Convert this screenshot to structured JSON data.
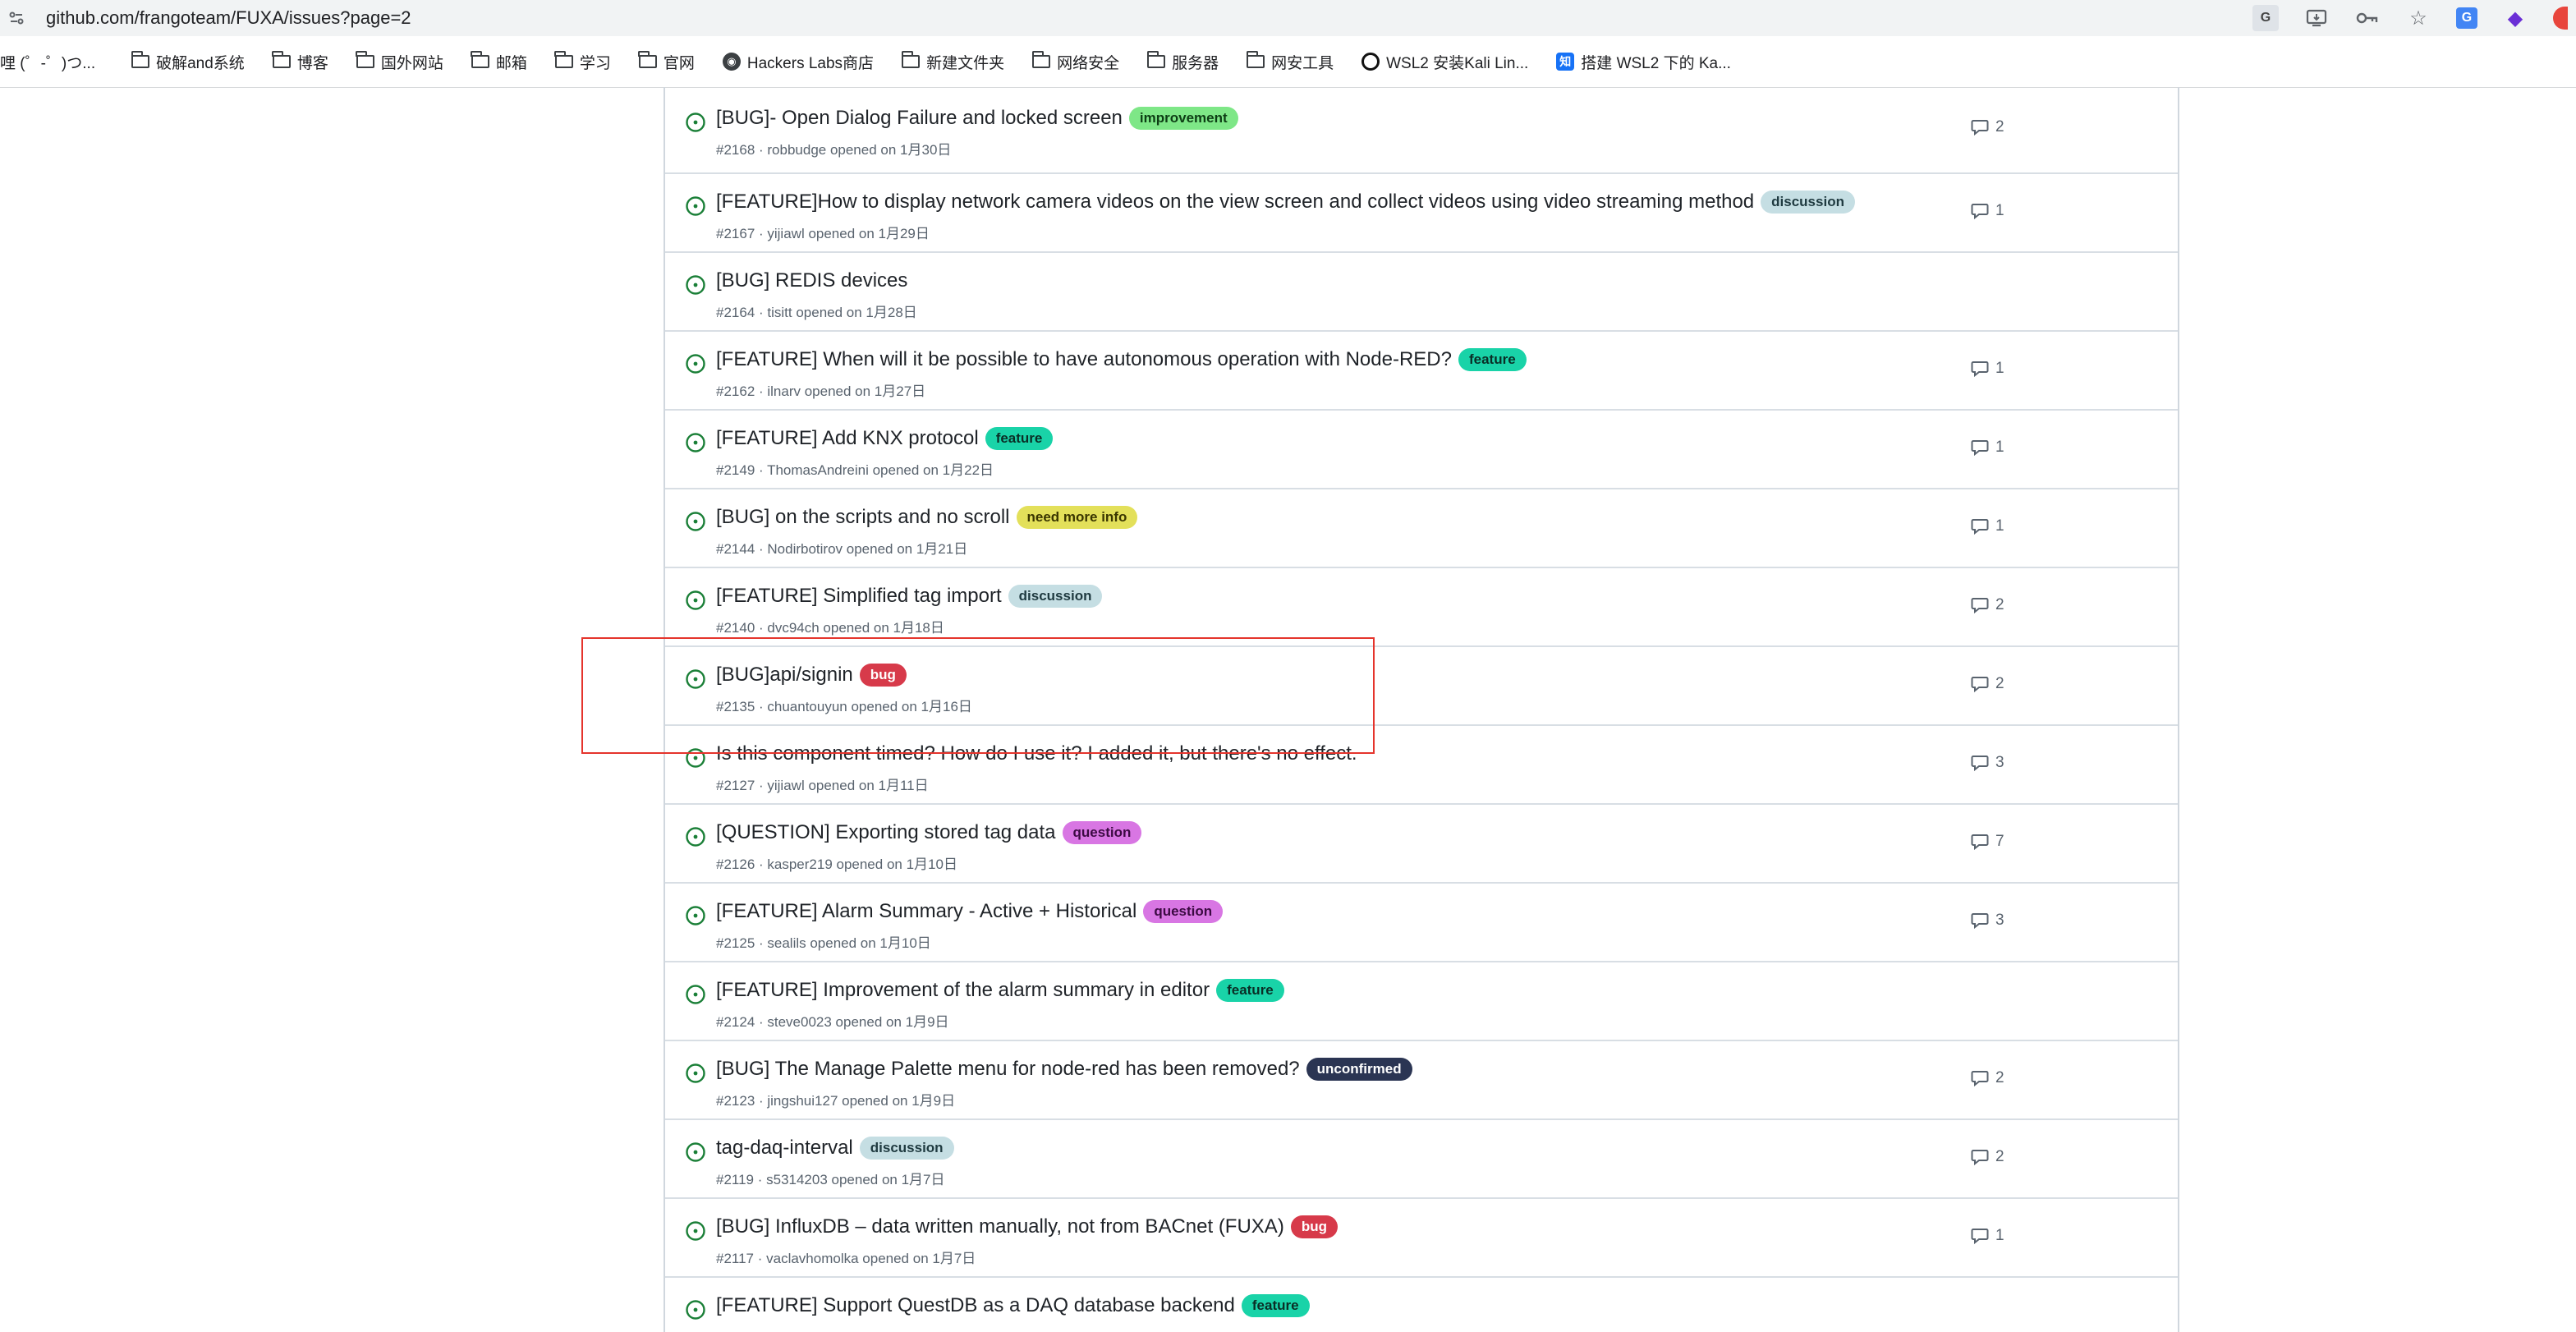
{
  "browser": {
    "url": "github.com/frangoteam/FUXA/issues?page=2",
    "bookmarks": [
      {
        "label": "哩 (゜-゜)つ...",
        "icon": "none"
      },
      {
        "label": "破解and系统",
        "icon": "folder-icon"
      },
      {
        "label": "博客",
        "icon": "folder-icon"
      },
      {
        "label": "国外网站",
        "icon": "folder-icon"
      },
      {
        "label": "邮箱",
        "icon": "folder-icon"
      },
      {
        "label": "学习",
        "icon": "folder-icon"
      },
      {
        "label": "官网",
        "icon": "folder-icon"
      },
      {
        "label": "Hackers Labs商店",
        "icon": "hackers-labs-icon"
      },
      {
        "label": "新建文件夹",
        "icon": "folder-icon"
      },
      {
        "label": "网络安全",
        "icon": "folder-icon"
      },
      {
        "label": "服务器",
        "icon": "folder-icon"
      },
      {
        "label": "网安工具",
        "icon": "folder-icon"
      },
      {
        "label": "WSL2 安装Kali Lin...",
        "icon": "github-icon"
      },
      {
        "label": "搭建 WSL2 下的 Ka...",
        "icon": "zhihu-icon"
      }
    ]
  },
  "issues": [
    {
      "title": "[BUG]- Open Dialog Failure and locked screen",
      "labels": [
        {
          "text": "improvement",
          "bg": "#7ee787",
          "fg": "#0d3d14"
        }
      ],
      "meta": "#2168 · robbudge opened on 1月30日",
      "comments": "2"
    },
    {
      "title": "[FEATURE]How to display network camera videos on the view screen and collect videos using video streaming method",
      "labels": [
        {
          "text": "discussion",
          "bg": "#c5dee3",
          "fg": "#1f3a40"
        }
      ],
      "meta": "#2167 · yijiawl opened on 1月29日",
      "comments": "1"
    },
    {
      "title": "[BUG] REDIS devices",
      "labels": [],
      "meta": "#2164 · tisitt opened on 1月28日",
      "comments": ""
    },
    {
      "title": "[FEATURE] When will it be possible to have autonomous operation with Node-RED?",
      "labels": [
        {
          "text": "feature",
          "bg": "#19d3a8",
          "fg": "#0a2e26"
        }
      ],
      "meta": "#2162 · ilnarv opened on 1月27日",
      "comments": "1"
    },
    {
      "title": "[FEATURE] Add KNX protocol",
      "labels": [
        {
          "text": "feature",
          "bg": "#19d3a8",
          "fg": "#0a2e26"
        }
      ],
      "meta": "#2149 · ThomasAndreini opened on 1月22日",
      "comments": "1"
    },
    {
      "title": "[BUG] on the scripts and no scroll",
      "labels": [
        {
          "text": "need more info",
          "bg": "#e3e05a",
          "fg": "#3a3600"
        }
      ],
      "meta": "#2144 · Nodirbotirov opened on 1月21日",
      "comments": "1"
    },
    {
      "title": "[FEATURE] Simplified tag import",
      "labels": [
        {
          "text": "discussion",
          "bg": "#c5dee3",
          "fg": "#1f3a40"
        }
      ],
      "meta": "#2140 · dvc94ch opened on 1月18日",
      "comments": "2"
    },
    {
      "title": "[BUG]api/signin",
      "labels": [
        {
          "text": "bug",
          "bg": "#d73a4a",
          "fg": "#ffffff"
        }
      ],
      "meta": "#2135 · chuantouyun opened on 1月16日",
      "comments": "2"
    },
    {
      "title": "Is this component timed? How do I use it? I added it, but there's no effect.",
      "labels": [],
      "meta": "#2127 · yijiawl opened on 1月11日",
      "comments": "3"
    },
    {
      "title": "[QUESTION] Exporting stored tag data",
      "labels": [
        {
          "text": "question",
          "bg": "#d876e3",
          "fg": "#3b0a42"
        }
      ],
      "meta": "#2126 · kasper219 opened on 1月10日",
      "comments": "7"
    },
    {
      "title": "[FEATURE] Alarm Summary - Active + Historical",
      "labels": [
        {
          "text": "question",
          "bg": "#d876e3",
          "fg": "#3b0a42"
        }
      ],
      "meta": "#2125 · sealils opened on 1月10日",
      "comments": "3"
    },
    {
      "title": "[FEATURE] Improvement of the alarm summary in editor",
      "labels": [
        {
          "text": "feature",
          "bg": "#19d3a8",
          "fg": "#0a2e26"
        }
      ],
      "meta": "#2124 · steve0023 opened on 1月9日",
      "comments": ""
    },
    {
      "title": "[BUG] The Manage Palette menu for node-red has been removed?",
      "labels": [
        {
          "text": "unconfirmed",
          "bg": "#2b3553",
          "fg": "#ffffff"
        }
      ],
      "meta": "#2123 · jingshui127 opened on 1月9日",
      "comments": "2"
    },
    {
      "title": "tag-daq-interval",
      "labels": [
        {
          "text": "discussion",
          "bg": "#c5dee3",
          "fg": "#1f3a40"
        }
      ],
      "meta": "#2119 · s5314203 opened on 1月7日",
      "comments": "2"
    },
    {
      "title": "[BUG] InfluxDB – data written manually, not from BACnet (FUXA)",
      "labels": [
        {
          "text": "bug",
          "bg": "#d73a4a",
          "fg": "#ffffff"
        }
      ],
      "meta": "#2117 · vaclavhomolka opened on 1月7日",
      "comments": "1"
    },
    {
      "title": "[FEATURE] Support QuestDB as a DAQ database backend",
      "labels": [
        {
          "text": "feature",
          "bg": "#19d3a8",
          "fg": "#0a2e26"
        }
      ],
      "meta": "",
      "comments": ""
    }
  ],
  "colors": {
    "open_issue": "#1a7f37",
    "highlight_box": "#e5342c"
  }
}
